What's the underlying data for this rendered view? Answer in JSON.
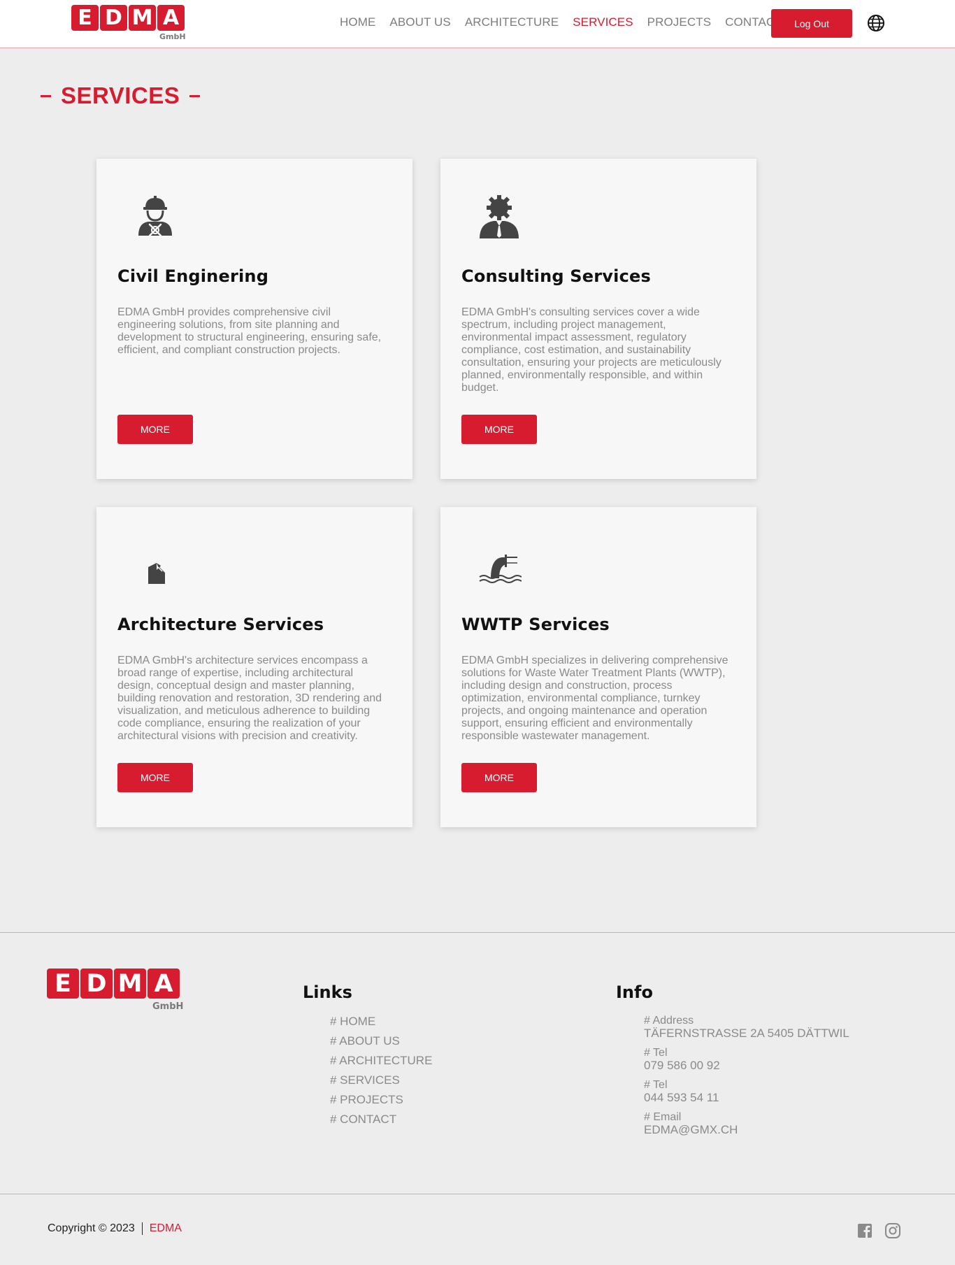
{
  "header": {
    "logo_letters": [
      "E",
      "D",
      "M",
      "A"
    ],
    "logo_sub": "GmbH",
    "nav": [
      {
        "label": "HOME",
        "active": false
      },
      {
        "label": "ABOUT US",
        "active": false
      },
      {
        "label": "ARCHITECTURE",
        "active": false
      },
      {
        "label": "SERVICES",
        "active": true
      },
      {
        "label": "PROJECTS",
        "active": false
      },
      {
        "label": "CONTACT",
        "active": false
      }
    ],
    "logout_label": "Log Out",
    "language_icon": "globe-icon"
  },
  "page": {
    "title": "SERVICES"
  },
  "services": [
    {
      "icon": "engineer-icon",
      "title": "Civil Enginering",
      "description": "EDMA GmbH provides comprehensive civil engineering solutions, from site planning and development to structural engineering, ensuring safe, efficient, and compliant construction projects.",
      "button": "MORE"
    },
    {
      "icon": "consultant-gear-icon",
      "title": "Consulting Services",
      "description": "EDMA GmbH's consulting services cover a wide spectrum, including project management, environmental impact assessment, regulatory compliance, cost estimation, and sustainability consultation, ensuring your projects are meticulously planned, environmentally responsible, and within budget.",
      "button": "MORE"
    },
    {
      "icon": "building-icon",
      "title": "Architecture Services",
      "description": "EDMA GmbH's architecture services encompass a broad range of expertise, including architectural design, conceptual design and master planning, building renovation and restoration, 3D rendering and visualization, and meticulous adherence to building code compliance, ensuring the realization of your architectural visions with precision and creativity.",
      "button": "MORE"
    },
    {
      "icon": "wastewater-pipe-icon",
      "title": "WWTP Services",
      "description": "EDMA GmbH specializes in delivering comprehensive solutions for Waste Water Treatment Plants (WWTP), including design and construction, process optimization, environmental compliance, turnkey projects, and ongoing maintenance and operation support, ensuring efficient and environmentally responsible wastewater management.",
      "button": "MORE"
    }
  ],
  "footer": {
    "links_title": "Links",
    "links": [
      "# HOME",
      "# ABOUT US",
      "# ARCHITECTURE",
      "# SERVICES",
      "# PROJECTS",
      "# CONTACT"
    ],
    "info_title": "Info",
    "info": [
      {
        "label": "# Address",
        "value": "TÄFERNSTRASSE 2A 5405 DÄTTWIL"
      },
      {
        "label": "# Tel",
        "value": "079 586 00 92"
      },
      {
        "label": "# Tel",
        "value": "044 593 54 11"
      },
      {
        "label": "# Email",
        "value": "EDMA@GMX.CH"
      }
    ],
    "copyright": "Copyright © 2023",
    "brand": "EDMA",
    "social": [
      "facebook-icon",
      "instagram-icon"
    ]
  },
  "colors": {
    "accent": "#d81c2f",
    "background": "#ededed",
    "card": "#f7f7f7",
    "muted_text": "#8a8a8a"
  }
}
